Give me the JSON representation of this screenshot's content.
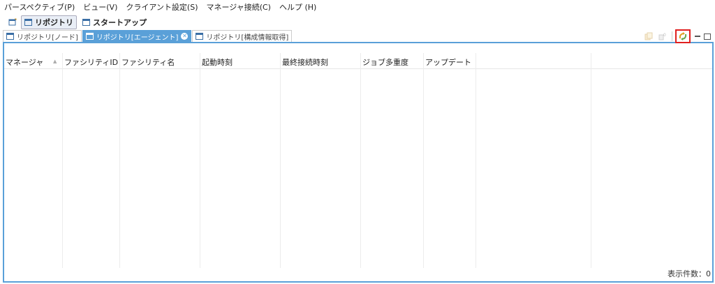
{
  "menubar": {
    "items": [
      "パースペクティブ(P)",
      "ビュー(V)",
      "クライアント設定(S)",
      "マネージャ接続(C)",
      "ヘルプ (H)"
    ]
  },
  "perspectives": {
    "items": [
      {
        "label": "リポジトリ",
        "active": true
      },
      {
        "label": "スタートアップ",
        "active": false
      }
    ]
  },
  "tabs": [
    {
      "label": "リポジトリ[ノード]",
      "active": false
    },
    {
      "label": "リポジトリ[エージェント]",
      "active": true
    },
    {
      "label": "リポジトリ[構成情報取得]",
      "active": false
    }
  ],
  "table": {
    "columns": [
      "マネージャ",
      "ファシリティID",
      "ファシリティ名",
      "起動時刻",
      "最終接続時刻",
      "ジョブ多重度",
      "アップデート",
      "",
      ""
    ]
  },
  "status": {
    "count_text": "表示件数：0"
  },
  "colors": {
    "accent": "#5aa0d8",
    "highlight": "#e02020"
  }
}
